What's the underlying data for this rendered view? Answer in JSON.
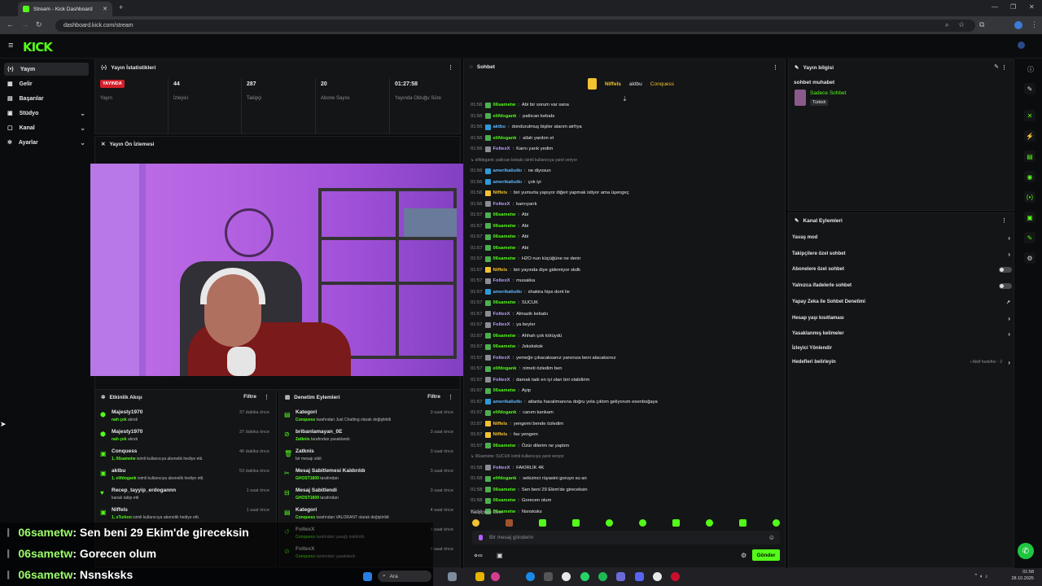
{
  "browser": {
    "tab_title": "Stream - Kick Dashboard",
    "url": "dashboard.kick.com/stream"
  },
  "brand": {
    "logo": "KICK",
    "accent": "#53fc18"
  },
  "sidebar": {
    "items": [
      {
        "label": "Yayın",
        "icon": "broadcast-icon",
        "active": true
      },
      {
        "label": "Gelir",
        "icon": "revenue-icon"
      },
      {
        "label": "Başarılar",
        "icon": "achievements-icon"
      },
      {
        "label": "Stüdyo",
        "icon": "studio-icon",
        "expandable": true
      },
      {
        "label": "Kanal",
        "icon": "channel-icon",
        "expandable": true
      },
      {
        "label": "Ayarlar",
        "icon": "settings-icon",
        "expandable": true
      }
    ]
  },
  "stats": {
    "title": "Yayın İstatistikleri",
    "live_badge": "YAYINDA",
    "live_label": "Yayın",
    "items": [
      {
        "value": "44",
        "label": "İzleyici"
      },
      {
        "value": "287",
        "label": "Takipçi"
      },
      {
        "value": "20",
        "label": "Abone Sayısı"
      },
      {
        "value": "01:27:58",
        "label": "Yayında Olduğu Süre"
      }
    ]
  },
  "preview": {
    "title": "Yayın Ön İzlemesi"
  },
  "activity": {
    "title": "Etkinlik Akışı",
    "filter": "Filtre",
    "rows": [
      {
        "name": "Majesty1970",
        "sub_b": "nah çek",
        "sub": " alındı",
        "time": "37 dakika önce",
        "icon": "⬢"
      },
      {
        "name": "Majesty1970",
        "sub_b": "nah çek",
        "sub": " alındı",
        "time": "37 dakika önce",
        "icon": "⬢"
      },
      {
        "name": "Conquess",
        "sub_b": "1, 06sametw",
        "sub": " isimli kullanıcıya abonelik hediye etti.",
        "time": "46 dakika önce",
        "icon": "▣"
      },
      {
        "name": "aktbu",
        "sub_b": "1, elifdogank",
        "sub": " isimli kullanıcıya abonelik hediye etti.",
        "time": "53 dakika önce",
        "icon": "▣"
      },
      {
        "name": "Recep_tayyip_erdogannn",
        "sub_b": "",
        "sub": "kanalı takip etti",
        "time": "1 saat önce",
        "icon": "♥"
      },
      {
        "name": "Niffels",
        "sub_b": "1, sTurkoo",
        "sub": " isimli kullanıcıya abonelik hediye etti.",
        "time": "1 saat önce",
        "icon": "▣"
      }
    ]
  },
  "moderation": {
    "title": "Denetim Eylemleri",
    "filter": "Filtre",
    "rows": [
      {
        "name": "Kategori",
        "sub_b": "Conquess",
        "sub": " tarafından Just Chatting olarak değiştirildi",
        "time": "3 saat önce",
        "icon": "▤"
      },
      {
        "name": "bribanlamayan_0E",
        "sub_b": "Zatknis",
        "sub": " tarafından yasaklandı",
        "time": "3 saat önce",
        "icon": "⊘"
      },
      {
        "name": "Zatknis",
        "sub_b": "",
        "sub": "bir mesajı sildi",
        "time": "3 saat önce",
        "icon": "🗑"
      },
      {
        "name": "Mesaj Sabitlemesi Kaldırıldı",
        "sub_b": "GHOST1809",
        "sub": " tarafından",
        "time": "3 saat önce",
        "icon": "✂"
      },
      {
        "name": "Mesaj Sabitlendi",
        "sub_b": "GHOST1809",
        "sub": " tarafından",
        "time": "3 saat önce",
        "icon": "⊟"
      },
      {
        "name": "Kategori",
        "sub_b": "Conquess",
        "sub": " tarafından VALORANT olarak değiştirildi",
        "time": "4 saat önce",
        "icon": "▤"
      },
      {
        "name": "FoltexX",
        "sub_b": "Conquess",
        "sub": " tarafından yasağı kaldırıldı",
        "time": "4 saat önce",
        "icon": "↺"
      },
      {
        "name": "FoltexX",
        "sub_b": "Conquess",
        "sub": " tarafından yasaklandı",
        "time": "4 saat önce",
        "icon": "⊘"
      }
    ]
  },
  "chat": {
    "title": "Sohbet",
    "top_gifters": [
      {
        "name": "Niffels",
        "count": "1"
      },
      {
        "name": "aktbu",
        "count": "1"
      },
      {
        "name": "Conquess",
        "count": "1"
      }
    ],
    "lines": [
      {
        "t": "01:56",
        "u": "06sametw",
        "c": "green",
        "m": "Abi bir sorum var sana"
      },
      {
        "t": "01:56",
        "u": "elifdogank",
        "c": "green",
        "m": "patlıcan kebabı"
      },
      {
        "t": "01:56",
        "u": "aktbu",
        "c": "blue",
        "m": "dondurulmuş bişiler atarım airfrya"
      },
      {
        "t": "01:56",
        "u": "elifdogank",
        "c": "green",
        "m": "allah yardım et"
      },
      {
        "t": "01:56",
        "u": "FoltexX",
        "c": "lilac",
        "m": "Karnı yarık yedim"
      },
      {
        "t": "",
        "u": "",
        "c": "reply",
        "m": "↳ elifdogank: patlıcan kebabı isimli kullanıcıya yanıt veriyor"
      },
      {
        "t": "01:56",
        "u": "amerikaliutkı",
        "c": "blue",
        "m": "ne diyosun"
      },
      {
        "t": "01:56",
        "u": "amerikaliutkı",
        "c": "blue",
        "m": "çok iyi"
      },
      {
        "t": "01:56",
        "u": "Niffels",
        "c": "yellow",
        "m": "biri yumurta yapıyor diğeri yapmak istiyor ama üşengeç"
      },
      {
        "t": "01:56",
        "u": "FoltexX",
        "c": "lilac",
        "m": "karnıyarık"
      },
      {
        "t": "01:57",
        "u": "06sametw",
        "c": "green",
        "m": "Abi"
      },
      {
        "t": "01:57",
        "u": "06sametw",
        "c": "green",
        "m": "Abi"
      },
      {
        "t": "01:57",
        "u": "06sametw",
        "c": "green",
        "m": "Abi"
      },
      {
        "t": "01:57",
        "u": "06sametw",
        "c": "green",
        "m": "Abi"
      },
      {
        "t": "01:57",
        "u": "06sametw",
        "c": "green",
        "m": "H2O nun küçüğüne ne denir"
      },
      {
        "t": "01:57",
        "u": "Niffels",
        "c": "yellow",
        "m": "biri yayında diye gidemiyor skdk"
      },
      {
        "t": "01:57",
        "u": "FoltexX",
        "c": "lilac",
        "m": "musakka"
      },
      {
        "t": "01:57",
        "u": "amerikaliutkı",
        "c": "blue",
        "m": "shakira hips dont lie"
      },
      {
        "t": "01:57",
        "u": "06sametw",
        "c": "green",
        "m": "SUCUK"
      },
      {
        "t": "01:57",
        "u": "FoltexX",
        "c": "lilac",
        "m": "Alinazik kebabı"
      },
      {
        "t": "01:57",
        "u": "FoltexX",
        "c": "lilac",
        "m": "ya beyler"
      },
      {
        "t": "01:57",
        "u": "06sametw",
        "c": "green",
        "m": "Ahhah çok kötüydü"
      },
      {
        "t": "01:57",
        "u": "06sametw",
        "c": "green",
        "m": "Jsksksksk"
      },
      {
        "t": "01:57",
        "u": "FoltexX",
        "c": "lilac",
        "m": "yemeğe çıkacaksanız yanınıza beni alacaksınız"
      },
      {
        "t": "01:57",
        "u": "elifdogank",
        "c": "green",
        "m": "nimeti özledim ben"
      },
      {
        "t": "01:57",
        "u": "FoltexX",
        "c": "lilac",
        "m": "damak tadı en iyi olan biri olabilirim"
      },
      {
        "t": "01:57",
        "u": "06sametw",
        "c": "green",
        "m": "Ayip"
      },
      {
        "t": "01:57",
        "u": "amerikaliutkı",
        "c": "blue",
        "m": "atlanta havalimanına doğru yola çıktım geliyorum esenboğaya"
      },
      {
        "t": "01:57",
        "u": "elifdogank",
        "c": "green",
        "m": "canım kankam"
      },
      {
        "t": "01:57",
        "u": "Niffels",
        "c": "yellow",
        "m": "yengemi bende özledim"
      },
      {
        "t": "01:57",
        "u": "Niffels",
        "c": "yellow",
        "m": "fav yengem"
      },
      {
        "t": "01:57",
        "u": "06sametw",
        "c": "green",
        "m": "Özür dilerim ne yaptım"
      },
      {
        "t": "",
        "u": "",
        "c": "reply",
        "m": "↳ 06sametw: SUCUK isimli kullanıcıya yanıt veriyor"
      },
      {
        "t": "01:58",
        "u": "FoltexX",
        "c": "lilac",
        "m": "FAKİRLİK 4K"
      },
      {
        "t": "01:58",
        "u": "elifdogank",
        "c": "green",
        "m": "sekizinci rüyasini goruyo su an"
      },
      {
        "t": "01:58",
        "u": "06sametw",
        "c": "green",
        "m": "Sen beni 29 Ekim'de gireceksin"
      },
      {
        "t": "01:58",
        "u": "06sametw",
        "c": "green",
        "m": "Gorecen olum"
      },
      {
        "t": "01:58",
        "u": "06sametw",
        "c": "green",
        "m": "Nsnsksks"
      }
    ],
    "followers_only": "Takipçilere Özel",
    "input_placeholder": "Bir mesaj gönderin",
    "send_label": "Gönder"
  },
  "stream_info": {
    "title": "Yayın bilgisi",
    "stream_title": "sohbet muhabet",
    "category": "Sadece Sohbet",
    "language_tag": "Türkish"
  },
  "channel_actions": {
    "title": "Kanal Eylemleri",
    "items": [
      {
        "label": "Yavaş mod",
        "kind": "arrow"
      },
      {
        "label": "Takipçilere özel sohbet",
        "kind": "arrow"
      },
      {
        "label": "Abonelere özel sohbet",
        "kind": "toggle"
      },
      {
        "label": "Yalnızca ifadelerle sohbet",
        "kind": "toggle"
      },
      {
        "label": "Yapay Zeka ile Sohbet Denetimi",
        "kind": "external"
      },
      {
        "label": "Hesap yaşı kısıtlaması",
        "kind": "arrow"
      },
      {
        "label": "Yasaklanmış kelimeler",
        "kind": "arrow"
      },
      {
        "label": "İzleyici Yönlendir",
        "kind": "none"
      },
      {
        "label": "Hedefleri belirleyin",
        "kind": "arrow",
        "extra": "• Aktif hedefler - 2"
      }
    ]
  },
  "overlay_chat": [
    {
      "user": "06sametw",
      "msg": ": Sen beni 29 Ekim'de gireceksin"
    },
    {
      "user": "06sametw",
      "msg": ": Gorecen olum"
    },
    {
      "user": "06sametw",
      "msg": ": Nsnsksks"
    }
  ],
  "taskbar": {
    "search": "Ara",
    "time": "01:58",
    "date": "28.10.2025"
  }
}
